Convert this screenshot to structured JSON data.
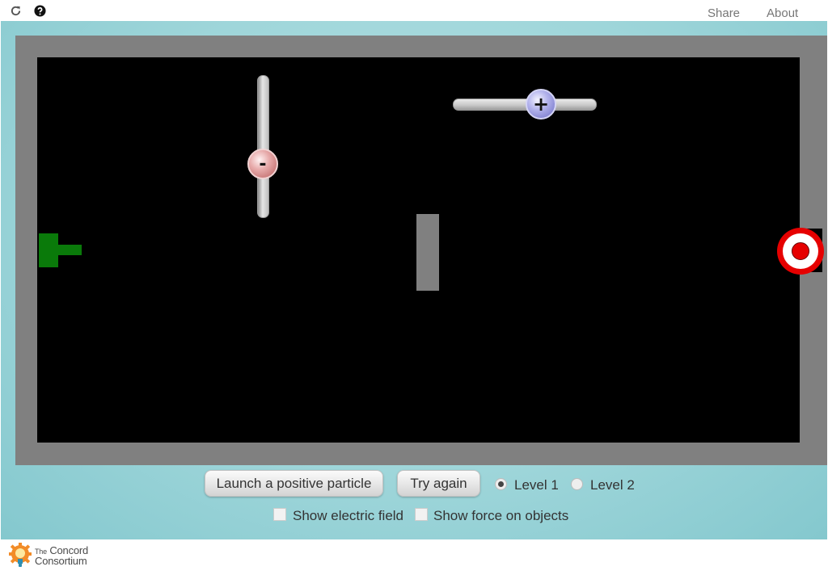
{
  "topbar": {
    "reload_icon": "reload-icon",
    "help_icon": "help-icon",
    "share_label": "Share",
    "about_label": "About"
  },
  "simulation": {
    "field_color": "#000000",
    "frame_color": "#808080",
    "cannon_color": "#0a7a0a",
    "negative_charge_symbol": "-",
    "positive_charge_symbol": "+",
    "negative_charge_color": "#d08a8a",
    "positive_charge_color": "#9d9de0",
    "target_color": "#e60000"
  },
  "controls": {
    "launch_label": "Launch a positive particle",
    "try_again_label": "Try again",
    "levels": [
      {
        "label": "Level 1",
        "selected": true
      },
      {
        "label": "Level 2",
        "selected": false
      }
    ],
    "show_field_label": "Show electric field",
    "show_field_checked": false,
    "show_force_label": "Show force on objects",
    "show_force_checked": false
  },
  "footer": {
    "logo_line1_small": "The",
    "logo_line1": "Concord",
    "logo_line2": "Consortium",
    "logo_icon": "lightbulb-gear-icon"
  }
}
